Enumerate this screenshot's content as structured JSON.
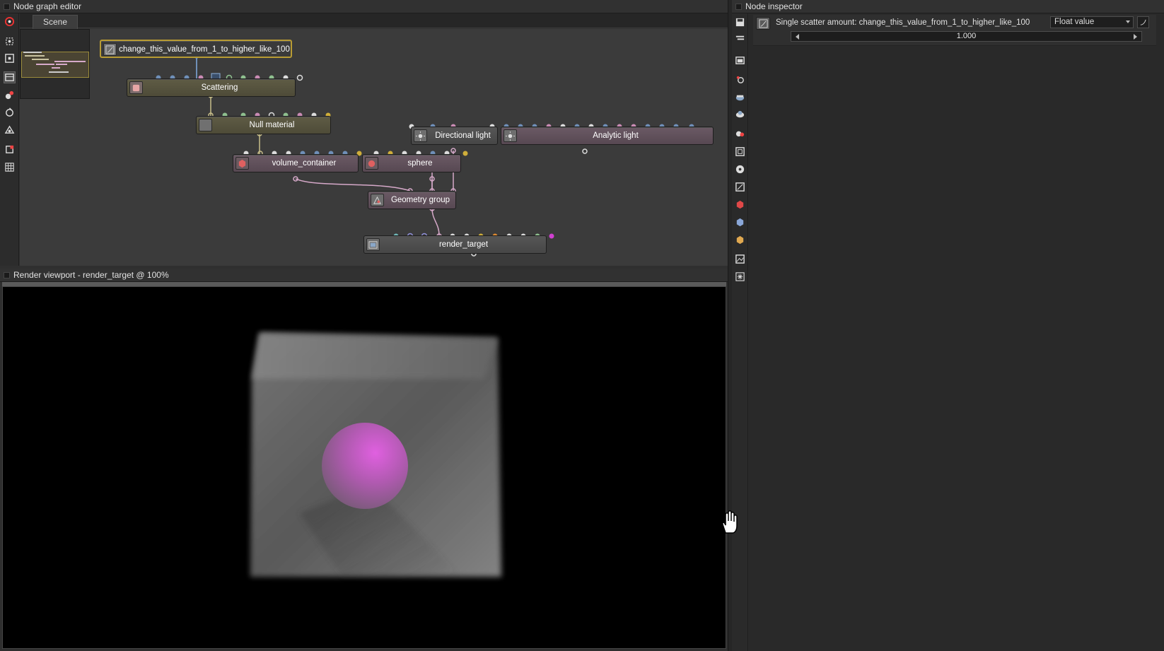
{
  "graph_editor": {
    "title": "Node graph editor",
    "tab": "Scene",
    "nodes": {
      "float_value": "change_this_value_from_1_to_higher_like_100",
      "scattering": "Scattering",
      "null_material": "Null material",
      "directional_light": "Directional light",
      "analytic_light": "Analytic light",
      "volume_container": "volume_container",
      "sphere": "sphere",
      "geometry_group": "Geometry group",
      "render_target": "render_target"
    }
  },
  "viewport": {
    "title": "Render viewport - render_target @ 100%"
  },
  "inspector": {
    "title": "Node inspector",
    "param_label": "Single scatter amount: change_this_value_from_1_to_higher_like_100",
    "value_type": "Float value",
    "value": "1.000"
  },
  "colors": {
    "accent": "#b89b33",
    "sphere": "#c45fc4",
    "pin_blue": "#6f8fb8",
    "pin_pink": "#c98bb4",
    "pin_green": "#8fc08f",
    "pin_yellow": "#cfae3a",
    "pin_white": "#dcdcdc"
  }
}
